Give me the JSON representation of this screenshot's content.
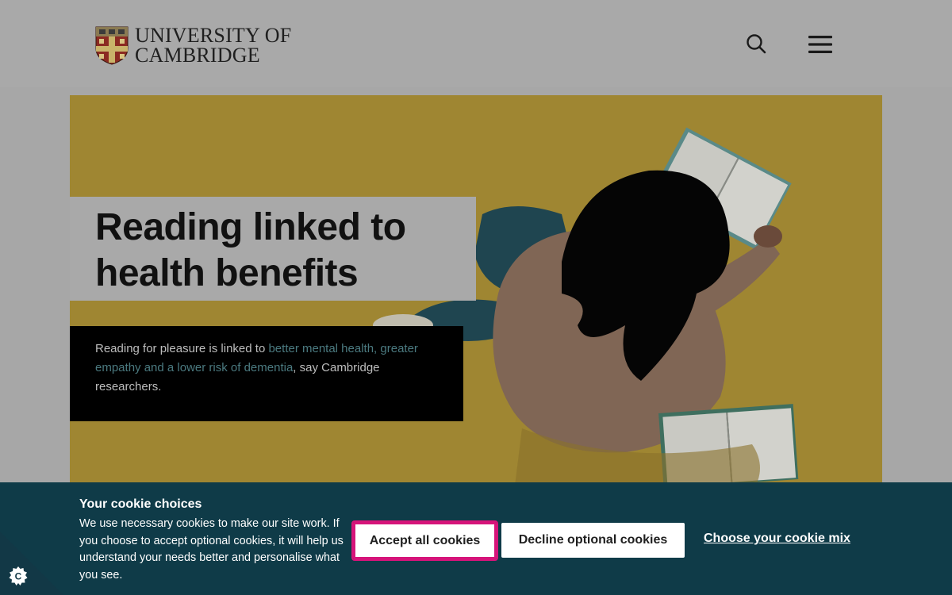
{
  "header": {
    "logo_line1": "UNIVERSITY OF",
    "logo_line2": "CAMBRIDGE",
    "icons": {
      "search": "search-icon",
      "menu": "hamburger-menu-icon",
      "crest": "university-crest-icon"
    }
  },
  "hero": {
    "headline": "Reading linked to health benefits",
    "summary_before": "Reading for pleasure is linked to ",
    "summary_link": "better mental health, greater empathy and a lower risk of dementia",
    "summary_after": ", say Cambridge researchers."
  },
  "cookie_banner": {
    "title": "Your cookie choices",
    "body": "We use necessary cookies to make our site work. If you choose to accept optional cookies, it will help us understand your needs better and personalise what you see.",
    "accept_label": "Accept all cookies",
    "decline_label": "Decline optional cookies",
    "mix_label": "Choose your cookie mix",
    "settings_icon": "cookie-settings-icon"
  },
  "colors": {
    "banner_bg": "#0f3b48",
    "accept_border": "#d6147a",
    "hero_bg": "#9f8632",
    "link": "#4b7a80"
  }
}
